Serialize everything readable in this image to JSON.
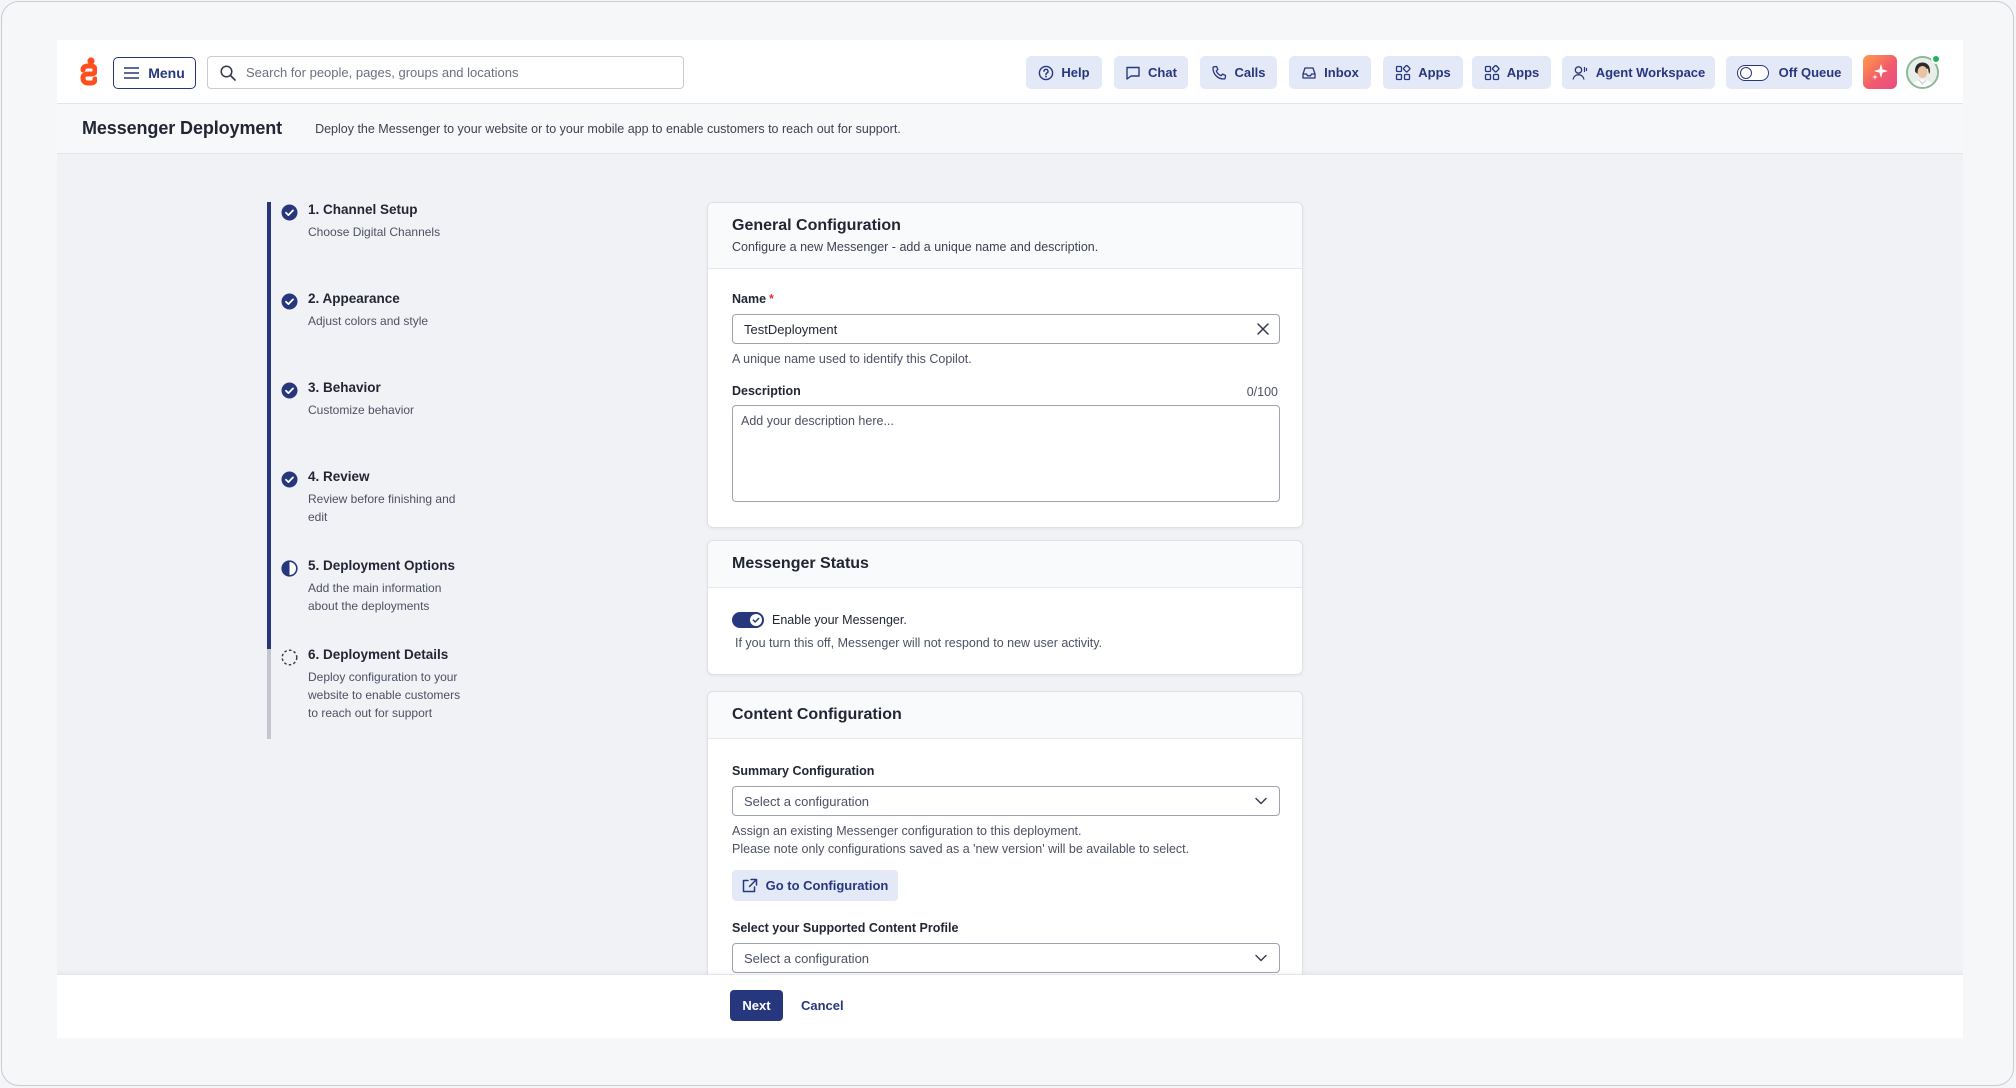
{
  "topbar": {
    "menu_label": "Menu",
    "search_placeholder": "Search for people, pages, groups and locations",
    "nav": {
      "help": "Help",
      "chat": "Chat",
      "calls": "Calls",
      "inbox": "Inbox",
      "apps1": "Apps",
      "apps2": "Apps",
      "agent_workspace": "Agent Workspace",
      "off_queue": "Off Queue"
    }
  },
  "page": {
    "title": "Messenger Deployment",
    "subtitle": "Deploy the Messenger to your website or to your mobile app to enable customers to reach out for support."
  },
  "steps": [
    {
      "title": "1. Channel Setup",
      "desc": "Choose Digital Channels",
      "status": "complete"
    },
    {
      "title": "2. Appearance",
      "desc": "Adjust colors and style",
      "status": "complete"
    },
    {
      "title": "3. Behavior",
      "desc": "Customize behavior",
      "status": "complete"
    },
    {
      "title": "4. Review",
      "desc": "Review before finishing and edit",
      "status": "complete"
    },
    {
      "title": "5. Deployment Options",
      "desc": "Add the main information about the deployments",
      "status": "in-progress"
    },
    {
      "title": "6. Deployment Details",
      "desc": "Deploy configuration to your website to enable customers to reach out for support",
      "status": "pending"
    }
  ],
  "general": {
    "title": "General Configuration",
    "subtitle": "Configure a new Messenger - add a unique name and description.",
    "name_label": "Name",
    "required_mark": "*",
    "name_value": "TestDeployment",
    "name_hint": "A unique name used to identify this Copilot.",
    "description_label": "Description",
    "description_count": "0/100",
    "description_placeholder": "Add your description here..."
  },
  "status": {
    "title": "Messenger Status",
    "toggle_label": "Enable your Messenger.",
    "toggle_on": true,
    "hint": "If you turn this off, Messenger will not respond to new user activity."
  },
  "content": {
    "title": "Content Configuration",
    "summary_label": "Summary Configuration",
    "summary_placeholder": "Select a configuration",
    "summary_hint_1": "Assign an existing Messenger configuration to this deployment.",
    "summary_hint_2": "Please note only configurations saved as a 'new version' will be available to select.",
    "goto_label": "Go to Configuration",
    "profile_label": "Select your Supported Content Profile",
    "profile_placeholder": "Select a configuration"
  },
  "footer": {
    "next_label": "Next",
    "cancel_label": "Cancel"
  },
  "colors": {
    "primary": "#27377e",
    "button_bg": "#e4e9f7",
    "required": "#e0363f",
    "presence": "#21b35c"
  }
}
